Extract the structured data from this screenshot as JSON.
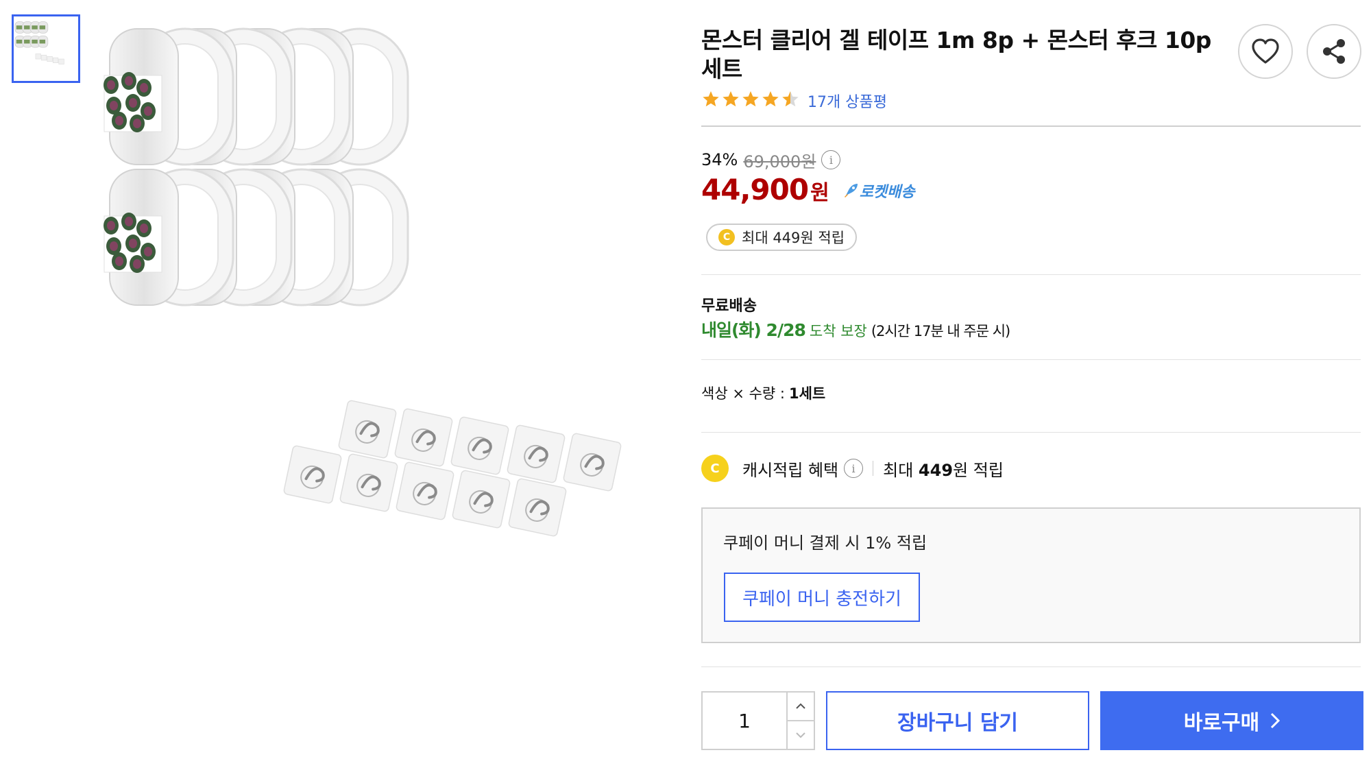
{
  "product": {
    "title": "몬스터 클리어 겔 테이프 1m 8p + 몬스터 후크 10p 세트",
    "rating_value": 4.5,
    "rating_max": 5,
    "review_count_text": "17개 상품평"
  },
  "price": {
    "discount": "34%",
    "original": "69,000원",
    "info_icon": "i",
    "sale": "44,900",
    "currency": "원",
    "delivery_badge": "로켓배송"
  },
  "cash_pill": {
    "coin": "C",
    "text": "최대 449원 적립"
  },
  "shipping": {
    "title": "무료배송",
    "arrival_date": "내일(화) 2/28",
    "arrival_text": "도착 보장",
    "cutoff": "(2시간 17분 내 주문 시)"
  },
  "option": {
    "label": "색상 × 수량 :",
    "value": "1세트"
  },
  "cash_benefit": {
    "coin": "C",
    "label": "캐시적립 혜택",
    "info_icon": "i",
    "max_prefix": "최대",
    "max_amount": "449",
    "max_suffix": "원 적립"
  },
  "coupay": {
    "description": "쿠페이 머니 결제 시 1% 적립",
    "charge_button": "쿠페이 머니 충전하기"
  },
  "purchase": {
    "quantity": "1",
    "cart_button": "장바구니 담기",
    "buy_button": "바로구매"
  },
  "icons": {
    "wishlist": "heart-icon",
    "share": "share-icon",
    "rocket": "rocket-icon",
    "stepper_up": "chevron-up-icon",
    "stepper_down": "chevron-down-icon",
    "buy_arrow": "chevron-right-icon"
  },
  "colors": {
    "accent_blue": "#3e6cf0",
    "sale_red": "#ae0000",
    "star_orange": "#f5a623",
    "arrival_green": "#2f8a2f",
    "coin_yellow": "#f6d11c"
  }
}
